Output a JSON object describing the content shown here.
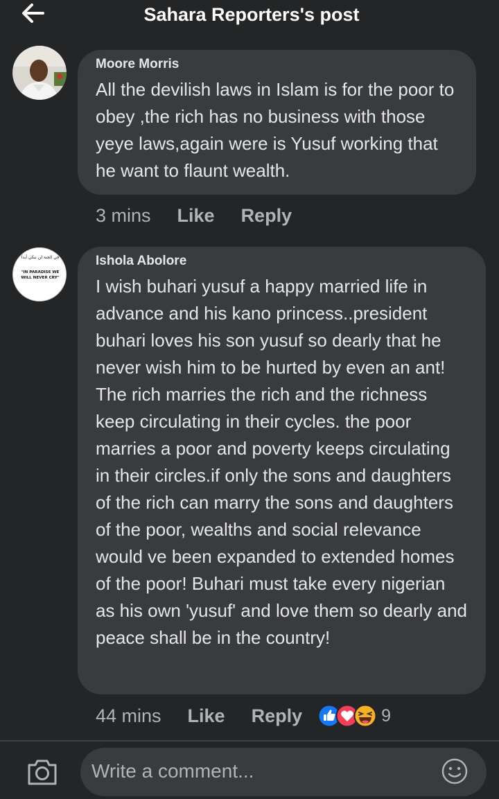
{
  "header": {
    "title": "Sahara Reporters's post",
    "back_icon": "arrow-left-icon"
  },
  "comments": [
    {
      "author": "Moore Morris",
      "text": "All the devilish laws in Islam is for the poor to obey ,the rich has no business with those yeye laws,again were is Yusuf working that he want to flaunt wealth.",
      "time": "3 mins",
      "like": "Like",
      "reply": "Reply"
    },
    {
      "author": "Ishola Abolore",
      "avatar_text_top": "في الجنة لن نبكي أبداً",
      "avatar_text_line1": "\"IN PARADISE WE",
      "avatar_text_line2": "WILL NEVER CRY\"",
      "text": "I wish buhari yusuf a happy married life in advance and his kano princess..president buhari loves his son yusuf so dearly that he never wish him to be hurted by even an ant! The rich marries the rich and the richness keep circulating in their cycles. the poor marries a poor and poverty keeps circulating in their circles.if only the sons and daughters of the rich can marry the sons and daughters of the poor, wealths and social relevance would ve been expanded to extended homes of the poor! Buhari must take every nigerian as his own 'yusuf' and love them so dearly and peace shall be in the country!",
      "time": "44 mins",
      "like": "Like",
      "reply": "Reply",
      "reactions": [
        "like-reaction-icon",
        "love-reaction-icon",
        "haha-reaction-icon"
      ],
      "reaction_count": "9"
    }
  ],
  "composer": {
    "placeholder": "Write a comment...",
    "camera_icon": "camera-icon",
    "emoji_icon": "emoji-icon"
  },
  "colors": {
    "background": "#242526",
    "bubble": "#3a3b3c",
    "text": "#e4e6eb",
    "secondary_text": "#b0b3b8",
    "like_blue": "#1877f2",
    "love_red": "#f33e58",
    "haha_yellow": "#f7b125"
  }
}
